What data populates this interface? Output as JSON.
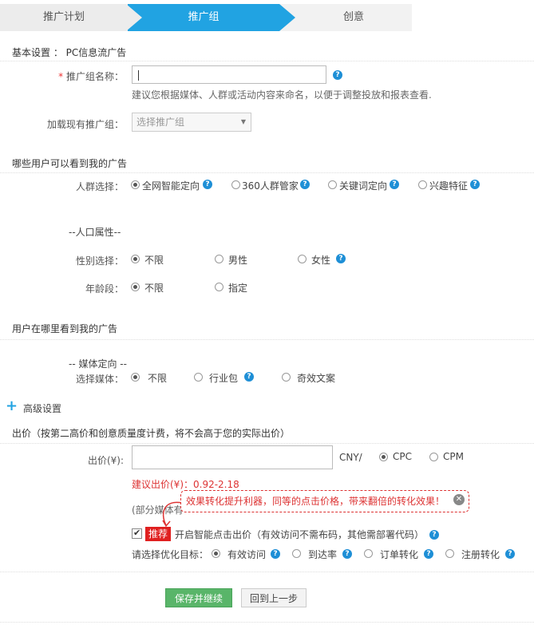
{
  "steps": [
    "推广计划",
    "推广组",
    "创意"
  ],
  "basic": {
    "header": "基本设置 ： PC信息流广告",
    "name_label": "推广组名称：",
    "name_required": "*",
    "name_value": "",
    "name_hint": "建议您根据媒体、人群或活动内容来命名，以便于调整投放和报表查看.",
    "load_label": "加载现有推广组：",
    "load_select": "选择推广组"
  },
  "who": {
    "header": "哪些用户可以看到我的广告",
    "crowd_label": "人群选择：",
    "crowd_options": [
      "全网智能定向",
      "360人群管家",
      "关键词定向",
      "兴趣特征"
    ],
    "crowd_selected": 0,
    "demo_header": "--人口属性--",
    "gender_label": "性别选择：",
    "gender_options": [
      "不限",
      "男性",
      "女性"
    ],
    "gender_selected": 0,
    "age_label": "年龄段：",
    "age_options": [
      "不限",
      "指定"
    ],
    "age_selected": 0
  },
  "where": {
    "header": "用户在哪里看到我的广告",
    "media_header": "-- 媒体定向 --",
    "media_label": "选择媒体：",
    "media_options": [
      "不限",
      "行业包",
      "奇效文案"
    ],
    "media_selected": 0
  },
  "advanced": {
    "label": "高级设置"
  },
  "bid": {
    "header": "出价（按第二高价和创意质量度计费，将不会高于您的实际出价）",
    "label": "出价(¥):",
    "value": "",
    "currency": "CNY/",
    "modes": [
      "CPC",
      "CPM"
    ],
    "mode_selected": 0,
    "suggest": "建议出价(¥)：0.92-2.18",
    "partial_note": "(部分媒体有",
    "tooltip": "效果转化提升利器，同等的点击价格，带来翻倍的转化效果！",
    "recommend_badge": "推荐",
    "smart_label": "开启智能点击出价（有效访问不需布码，其他需部署代码）",
    "goal_label": "请选择优化目标：",
    "goals": [
      "有效访问",
      "到达率",
      "订单转化",
      "注册转化"
    ],
    "goal_selected": 0
  },
  "buttons": {
    "save": "保存并继续",
    "back": "回到上一步"
  },
  "colors": {
    "accent": "#21a3e2",
    "save": "#59b569",
    "warn": "#d33333"
  }
}
